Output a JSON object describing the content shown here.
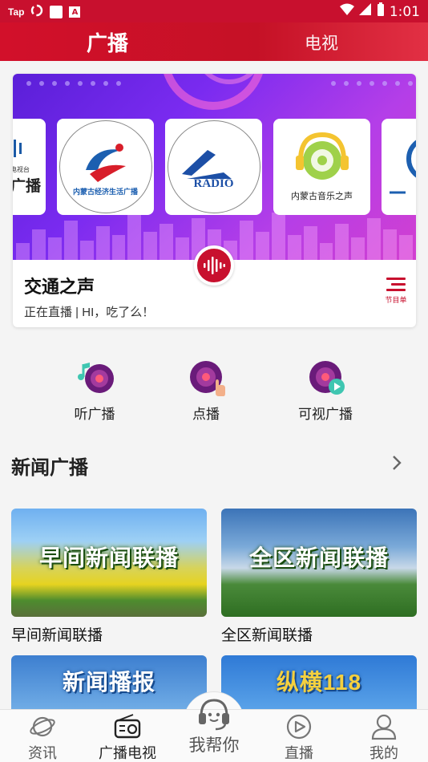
{
  "status_bar": {
    "left_label": "Tap",
    "badge_letter": "A",
    "time": "1:01"
  },
  "top_tabs": [
    {
      "label": "广播",
      "active": true
    },
    {
      "label": "电视",
      "active": false
    }
  ],
  "banner": {
    "partial_left_card": {
      "line1": "电视台",
      "line2": "广播"
    },
    "logo_cards": [
      {
        "caption": "内蒙古经济生活广播"
      },
      {
        "caption": "RADIO"
      },
      {
        "caption": "内蒙古音乐之声"
      },
      {
        "caption": ""
      }
    ],
    "station_name": "交通之声",
    "now_playing": "正在直播 | HI，吃了么！",
    "schedule_label": "节目单"
  },
  "quick_actions": [
    {
      "label": "听广播",
      "icon": "music-note-disc-icon"
    },
    {
      "label": "点播",
      "icon": "disc-tap-icon"
    },
    {
      "label": "可视广播",
      "icon": "disc-play-icon"
    }
  ],
  "section": {
    "title": "新闻广播",
    "more_icon": "chevron-right-icon"
  },
  "programs": [
    {
      "title": "早间新闻联播",
      "overlay": "早间新闻联播"
    },
    {
      "title": "全区新闻联播",
      "overlay": "全区新闻联播"
    },
    {
      "title": "",
      "overlay": "新闻播报"
    },
    {
      "title": "",
      "overlay": "纵横118"
    }
  ],
  "bottom_nav": [
    {
      "label": "资讯",
      "icon": "planet-icon",
      "active": false
    },
    {
      "label": "广播电视",
      "icon": "radio-icon",
      "active": true
    },
    {
      "label": "我帮你",
      "icon": "headset-icon",
      "active": false
    },
    {
      "label": "直播",
      "icon": "play-circle-icon",
      "active": false
    },
    {
      "label": "我的",
      "icon": "user-icon",
      "active": false
    }
  ],
  "colors": {
    "brand_red": "#c8102e",
    "banner_purple": "#7a2bf0"
  }
}
